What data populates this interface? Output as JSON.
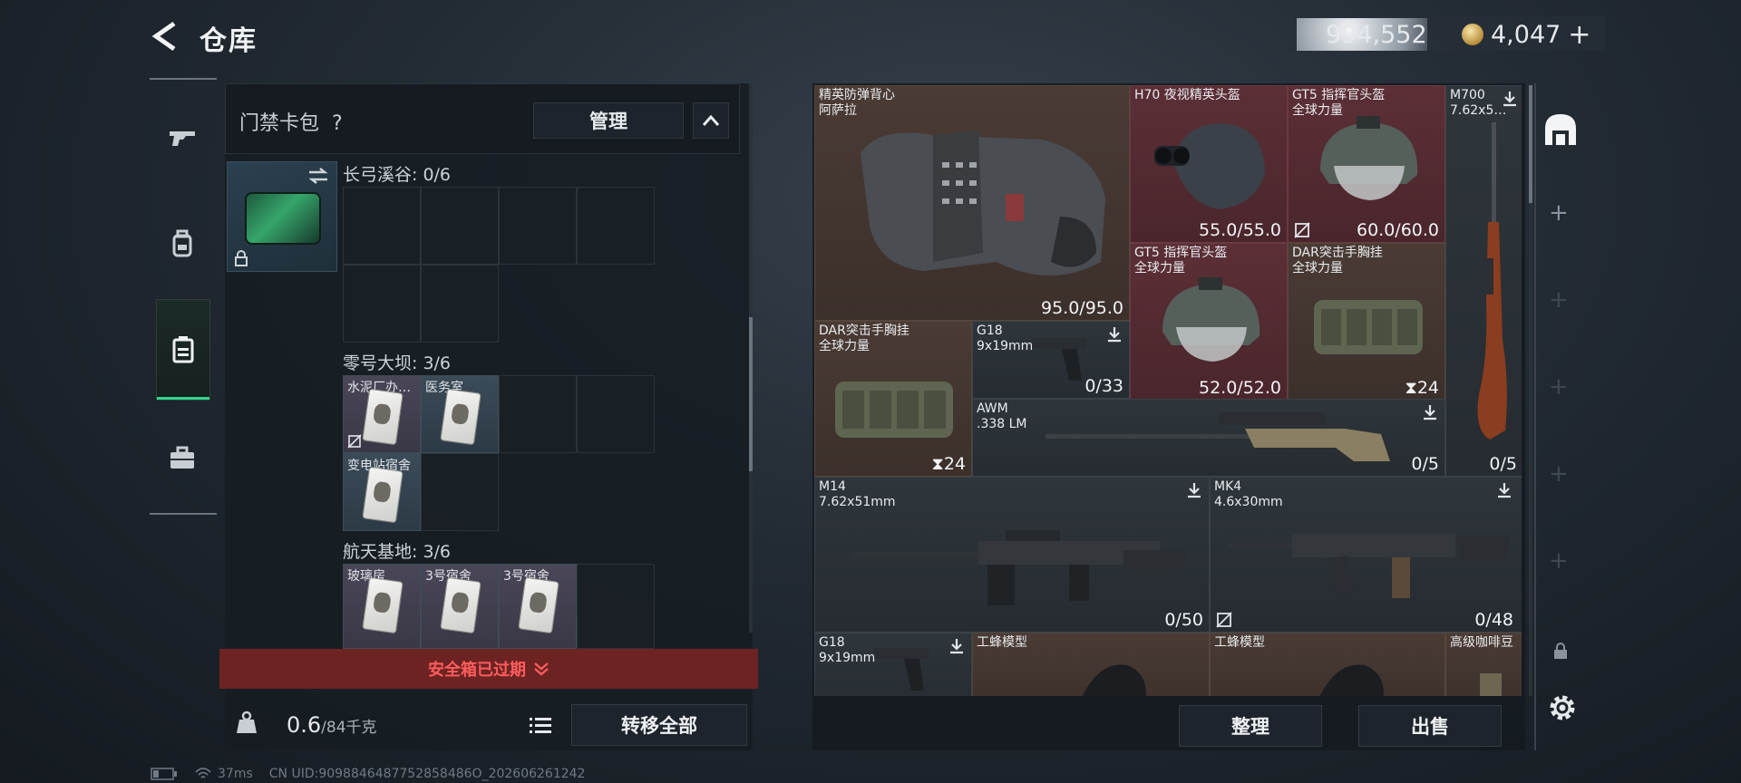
{
  "header": {
    "title": "仓库",
    "currency_silver": "994,552",
    "currency_gold": "4,047",
    "gold_add": "+"
  },
  "rail": {
    "items": [
      "gun-icon",
      "backpack-icon",
      "keycard-box-icon",
      "briefcase-icon"
    ],
    "active_index": 2
  },
  "left": {
    "header_label": "门禁卡包",
    "help": "?",
    "manage_label": "管理",
    "zones": [
      {
        "name": "长弓溪谷: 0/6",
        "cards": []
      },
      {
        "name": "零号大坝: 3/6",
        "cards": [
          "水泥厂办…",
          "医务室",
          "变电站宿舍"
        ]
      },
      {
        "name": "航天基地: 3/6",
        "cards": [
          "玻璃房",
          "3号宿舍",
          "3号宿舍"
        ]
      }
    ],
    "expired_text": "安全箱已过期",
    "weight_value": "0.6",
    "weight_max": "/84千克",
    "transfer_all": "转移全部"
  },
  "status": {
    "ping": "37ms",
    "uid": "CN UID:9098846487752858486O_202606261242"
  },
  "stash": {
    "items": [
      {
        "name": "精英防弹背心\n阿萨拉",
        "durability": "95.0/95.0",
        "tint": "brown"
      },
      {
        "name": "H70 夜视精英头盔",
        "durability": "55.0/55.0",
        "tint": "red"
      },
      {
        "name": "GT5 指挥官头盔\n全球力量",
        "durability": "60.0/60.0",
        "tint": "red"
      },
      {
        "name": "M700\n7.62x5…",
        "ammo": "0/5",
        "tint": "gray"
      },
      {
        "name": "GT5 指挥官头盔\n全球力量",
        "durability": "52.0/52.0",
        "tint": "red"
      },
      {
        "name": "DAR突击手胸挂\n全球力量",
        "stack": "24",
        "tint": "brown"
      },
      {
        "name": "DAR突击手胸挂\n全球力量",
        "stack": "24",
        "tint": "brown"
      },
      {
        "name": "G18\n9x19mm",
        "ammo": "0/33",
        "tint": "gray"
      },
      {
        "name": "AWM\n.338 LM",
        "ammo": "0/5",
        "tint": "gray"
      },
      {
        "name": "M14\n7.62x51mm",
        "ammo": "0/50",
        "tint": "gray"
      },
      {
        "name": "MK4\n4.6x30mm",
        "ammo": "0/48",
        "tint": "gray"
      },
      {
        "name": "G18\n9x19mm",
        "tint": "gray"
      },
      {
        "name": "工蜂模型",
        "tint": "brown"
      },
      {
        "name": "工蜂模型",
        "tint": "brown"
      },
      {
        "name": "高级咖啡豆",
        "tint": "brown"
      }
    ],
    "tidy_label": "整理",
    "sell_label": "出售"
  }
}
